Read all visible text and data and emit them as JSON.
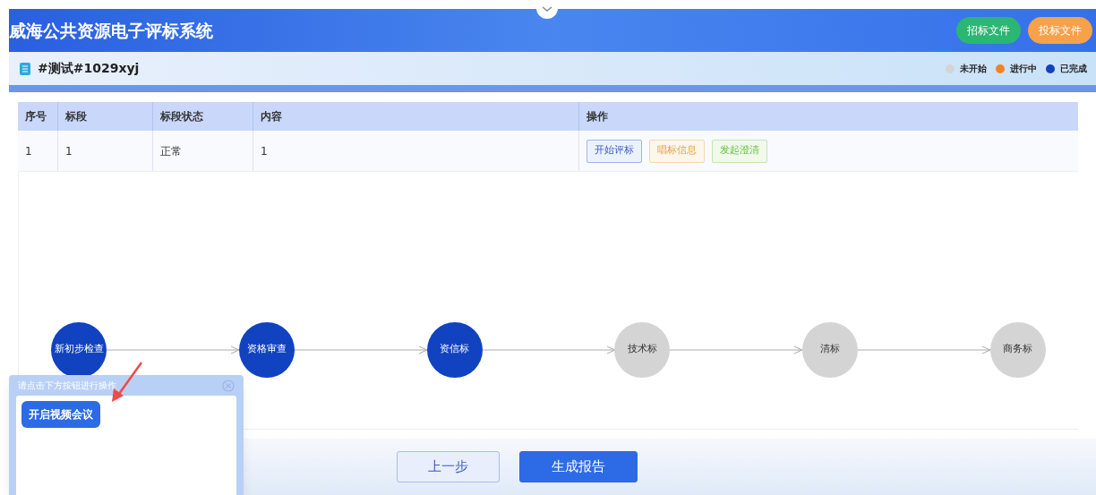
{
  "header": {
    "title": "威海公共资源电子评标系统",
    "buttons": [
      {
        "label": "招标文件",
        "color": "#2bb673"
      },
      {
        "label": "投标文件",
        "color": "#f7a14a"
      }
    ]
  },
  "project": {
    "name": "#测试#1029xyj"
  },
  "legend": [
    {
      "label": "未开始",
      "color": "#d4d4d4"
    },
    {
      "label": "进行中",
      "color": "#f58220"
    },
    {
      "label": "已完成",
      "color": "#1142c0"
    }
  ],
  "table": {
    "columns": [
      "序号",
      "标段",
      "标段状态",
      "内容",
      "操作"
    ],
    "rows": [
      {
        "cells": [
          "1",
          "1",
          "正常",
          "1"
        ],
        "actions": [
          {
            "label": "开始评标",
            "kind": "blue"
          },
          {
            "label": "唱标信息",
            "kind": "orange"
          },
          {
            "label": "发起澄清",
            "kind": "green"
          }
        ]
      }
    ]
  },
  "flow": [
    {
      "label": "新初步检查",
      "done": true
    },
    {
      "label": "资格审查",
      "done": true
    },
    {
      "label": "资信标",
      "done": true
    },
    {
      "label": "技术标",
      "done": false
    },
    {
      "label": "清标",
      "done": false
    },
    {
      "label": "商务标",
      "done": false
    }
  ],
  "popup": {
    "title": "请点击下方按钮进行操作",
    "button": "开启视频会议"
  },
  "footer": {
    "buttons": [
      {
        "label": "上一步",
        "kind": "secondary"
      },
      {
        "label": "生成报告",
        "kind": "primary"
      }
    ]
  }
}
